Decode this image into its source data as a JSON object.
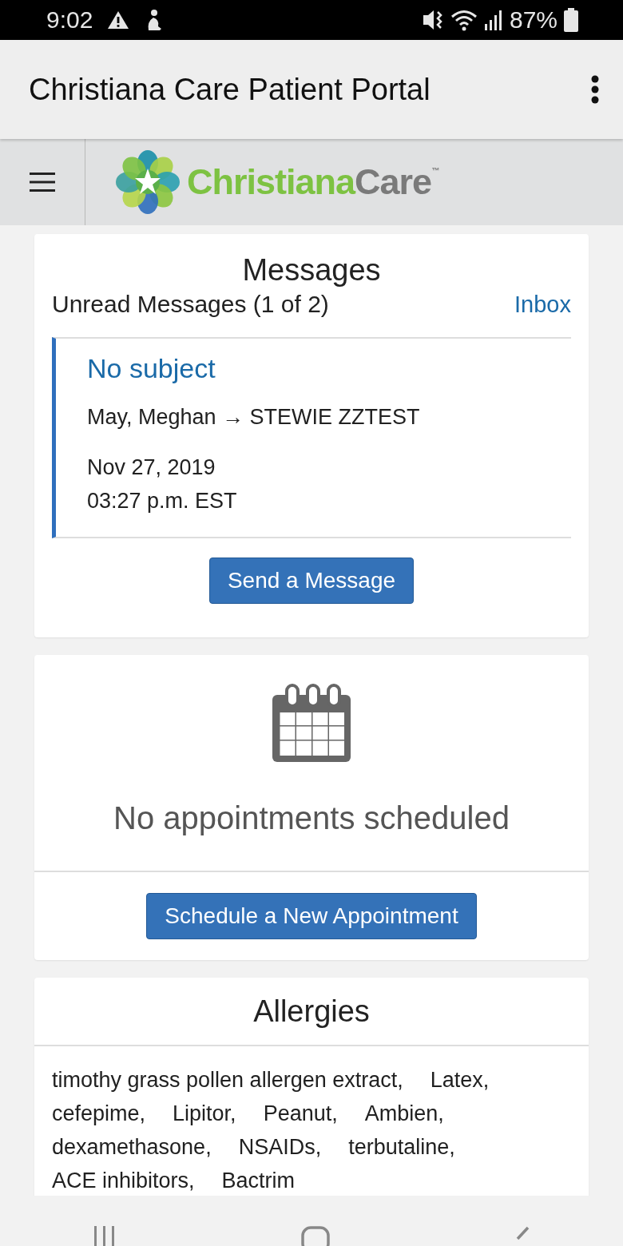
{
  "status_bar": {
    "time": "9:02",
    "battery": "87%"
  },
  "app_bar": {
    "title": "Christiana Care Patient Portal"
  },
  "header": {
    "logo": {
      "primary": "Christiana",
      "secondary": "Care",
      "mark": "™"
    }
  },
  "messages": {
    "title": "Messages",
    "unread": "Unread Messages (1 of 2)",
    "inbox_link": "Inbox",
    "message": {
      "subject": "No subject",
      "route": "May, Meghan → STEWIE ZZTEST",
      "date": "Nov 27, 2019",
      "time": "03:27 p.m. EST"
    },
    "button": "Send a Message"
  },
  "appointments": {
    "empty_text": "No appointments scheduled",
    "button": "Schedule a New Appointment"
  },
  "allergies": {
    "title": "Allergies",
    "items": [
      "timothy grass pollen allergen extract,",
      "Latex,",
      "cefepime,",
      "Lipitor,",
      "Peanut,",
      "Ambien,",
      "dexamethasone,",
      "NSAIDs,",
      "terbutaline,",
      "ACE inhibitors,",
      "Bactrim"
    ]
  }
}
